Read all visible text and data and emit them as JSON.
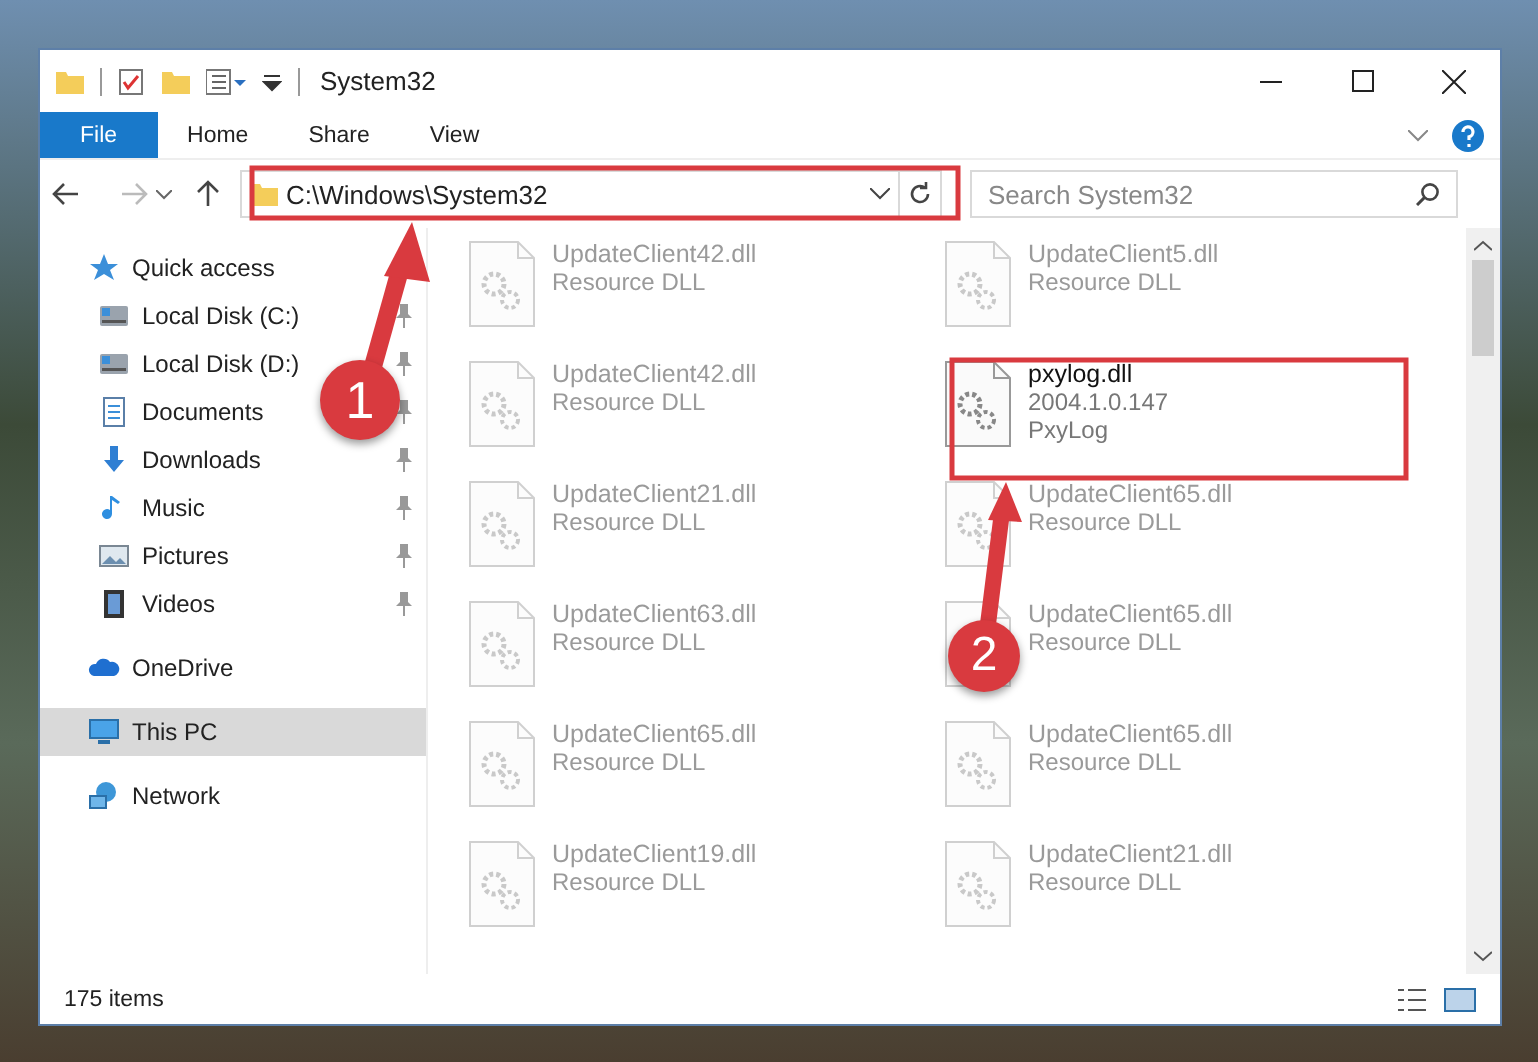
{
  "window": {
    "title": "System32"
  },
  "ribbon_tabs": [
    {
      "label": "File",
      "selected": true
    },
    {
      "label": "Home",
      "selected": false
    },
    {
      "label": "Share",
      "selected": false
    },
    {
      "label": "View",
      "selected": false
    }
  ],
  "address_bar": {
    "path": "C:\\Windows\\System32"
  },
  "search": {
    "placeholder": "Search System32"
  },
  "sidebar": {
    "items": [
      {
        "label": "Quick access",
        "kind": "star",
        "selected": false,
        "children": [
          {
            "label": "Local Disk (C:)",
            "kind": "drive",
            "pinned": true,
            "selected": false
          },
          {
            "label": "Local Disk (D:)",
            "kind": "drive",
            "pinned": true,
            "selected": false
          },
          {
            "label": "Documents",
            "kind": "document",
            "pinned": true,
            "selected": false
          },
          {
            "label": "Downloads",
            "kind": "download",
            "pinned": true,
            "selected": false
          },
          {
            "label": "Music",
            "kind": "music",
            "pinned": true,
            "selected": false
          },
          {
            "label": "Pictures",
            "kind": "picture",
            "pinned": true,
            "selected": false
          },
          {
            "label": "Videos",
            "kind": "video",
            "pinned": true,
            "selected": false
          }
        ]
      },
      {
        "label": "OneDrive",
        "kind": "cloud",
        "selected": false
      },
      {
        "label": "This PC",
        "kind": "monitor",
        "selected": true
      },
      {
        "label": "Network",
        "kind": "network",
        "selected": false
      }
    ]
  },
  "files": [
    {
      "name": "UpdateClient42.dll",
      "details": [
        "Resource DLL"
      ],
      "blurred": true
    },
    {
      "name": "UpdateClient5.dll",
      "details": [
        "Resource DLL"
      ],
      "blurred": true
    },
    {
      "name": "UpdateClient42.dll",
      "details": [
        "Resource DLL"
      ],
      "blurred": true
    },
    {
      "name": "pxylog.dll",
      "details": [
        "2004.1.0.147",
        "PxyLog"
      ],
      "blurred": false
    },
    {
      "name": "UpdateClient21.dll",
      "details": [
        "Resource DLL"
      ],
      "blurred": true
    },
    {
      "name": "UpdateClient65.dll",
      "details": [
        "Resource DLL"
      ],
      "blurred": true
    },
    {
      "name": "UpdateClient63.dll",
      "details": [
        "Resource DLL"
      ],
      "blurred": true
    },
    {
      "name": "UpdateClient65.dll",
      "details": [
        "Resource DLL"
      ],
      "blurred": true
    },
    {
      "name": "UpdateClient65.dll",
      "details": [
        "Resource DLL"
      ],
      "blurred": true
    },
    {
      "name": "UpdateClient65.dll",
      "details": [
        "Resource DLL"
      ],
      "blurred": true
    },
    {
      "name": "UpdateClient19.dll",
      "details": [
        "Resource DLL"
      ],
      "blurred": true
    },
    {
      "name": "UpdateClient21.dll",
      "details": [
        "Resource DLL"
      ],
      "blurred": true
    }
  ],
  "status_bar": {
    "item_count": "175 items"
  },
  "annotations": [
    {
      "label": "1"
    },
    {
      "label": "2"
    }
  ]
}
